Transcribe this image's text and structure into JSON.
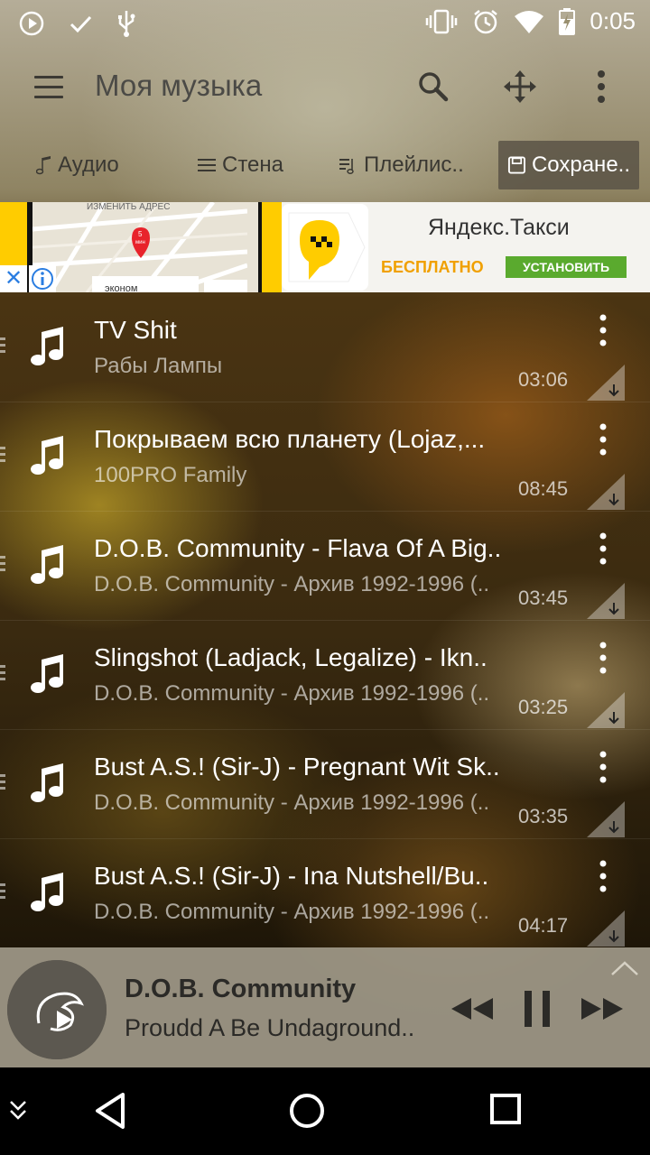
{
  "status_bar": {
    "time": "0:05",
    "icons": [
      "play-icon",
      "check-icon",
      "usb-icon",
      "vibrate-icon",
      "alarm-icon",
      "wifi-icon",
      "battery-charging-icon"
    ]
  },
  "toolbar": {
    "title": "Моя музыка",
    "icons": [
      "menu-icon",
      "search-icon",
      "move-icon",
      "more-vert-icon"
    ]
  },
  "tabs": [
    {
      "label": "Аудио",
      "icon": "note-icon",
      "active": false
    },
    {
      "label": "Стена",
      "icon": "list-icon",
      "active": false
    },
    {
      "label": "Плейлис..",
      "icon": "playlist-icon",
      "active": false
    },
    {
      "label": "Сохране..",
      "icon": "save-icon",
      "active": true
    }
  ],
  "ad": {
    "map_label": "ИЗМЕНИТЬ АДРЕС",
    "map_pin": "5",
    "map_pin_sub": "мин",
    "map_bottom": "эконом",
    "title": "Яндекс.Такси",
    "free": "БЕСПЛАТНО",
    "install": "УСТАНОВИТЬ",
    "colors": {
      "yellow": "#ffcc00",
      "install_green": "#5aaa2e",
      "free_orange": "#f0a000"
    }
  },
  "tracks": [
    {
      "title": "TV Shit",
      "artist": "Рабы Лампы",
      "duration": "03:06"
    },
    {
      "title": "Покрываем всю планету (Lojaz,...",
      "artist": "100PRO Family",
      "duration": "08:45"
    },
    {
      "title": "D.O.B. Community - Flava Of A Big..",
      "artist": "D.O.B. Community - Архив 1992-1996 (..",
      "duration": "03:45"
    },
    {
      "title": "Slingshot (Ladjack, Legalize) - Ikn..",
      "artist": "D.O.B. Community - Архив 1992-1996 (..",
      "duration": "03:25"
    },
    {
      "title": "Bust A.S.! (Sir-J) - Pregnant Wit Sk..",
      "artist": "D.O.B. Community - Архив 1992-1996 (..",
      "duration": "03:35"
    },
    {
      "title": "Bust A.S.! (Sir-J) - Ina Nutshell/Bu..",
      "artist": "D.O.B. Community - Архив 1992-1996 (..",
      "duration": "04:17"
    }
  ],
  "player": {
    "artist": "D.O.B. Community",
    "track": "Proudd A Be Undaground..",
    "controls": [
      "rewind-icon",
      "pause-icon",
      "fast-forward-icon"
    ]
  },
  "nav_bar": {
    "icons": [
      "collapse-icon",
      "back-icon",
      "home-icon",
      "recents-icon"
    ]
  }
}
